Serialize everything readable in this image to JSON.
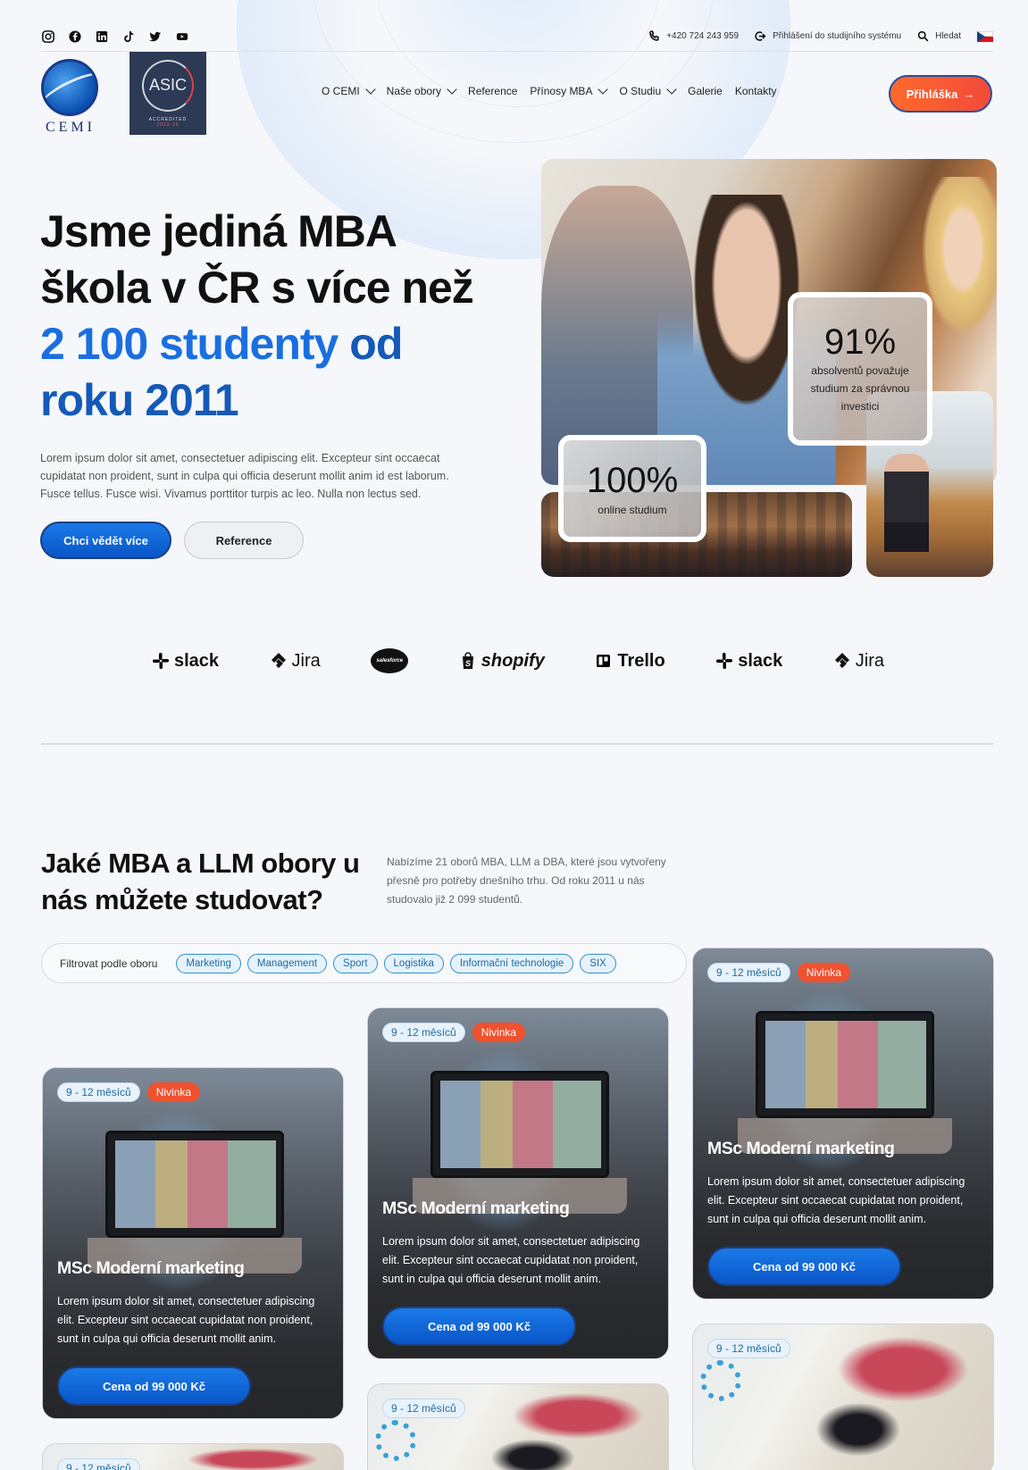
{
  "topbar": {
    "socials": [
      "instagram-icon",
      "facebook-icon",
      "linkedin-icon",
      "tiktok-icon",
      "twitter-icon",
      "youtube-icon"
    ],
    "phone": "+420 724 243 959",
    "login": "Přihlášení do studijního systému",
    "search": "Hledat",
    "language": "cs"
  },
  "header": {
    "logo_text": "CEMI",
    "asic": {
      "text": "ASIC",
      "accredited": "ACCREDITED",
      "years": "2023-26"
    },
    "nav": [
      {
        "label": "O CEMI",
        "dropdown": true
      },
      {
        "label": "Naše obory",
        "dropdown": true
      },
      {
        "label": "Reference",
        "dropdown": false
      },
      {
        "label": "Přínosy MBA",
        "dropdown": true
      },
      {
        "label": "O Studiu",
        "dropdown": true
      },
      {
        "label": "Galerie",
        "dropdown": false
      },
      {
        "label": "Kontakty",
        "dropdown": false
      }
    ],
    "apply_label": "Přihláška",
    "apply_arrow": "→"
  },
  "hero": {
    "title_part1": "Jsme jediná MBA škola v ČR s více než ",
    "title_highlight": "2 100 studenty",
    "title_highlight2": "od roku 2011",
    "text": "Lorem ipsum dolor sit amet, consectetuer adipiscing elit. Excepteur sint occaecat cupidatat non proident, sunt in culpa qui officia deserunt mollit anim id est laborum. Fusce tellus. Fusce wisi. Vivamus porttitor turpis ac leo. Nulla non lectus sed.",
    "primary_btn": "Chci vědět více",
    "secondary_btn": "Reference",
    "stat1_value": "91%",
    "stat1_label": "absolventů považuje studium za správnou investici",
    "stat2_value": "100%",
    "stat2_label": "online studium"
  },
  "brands": [
    "slack",
    "Jira",
    "salesforce",
    "shopify",
    "Trello",
    "slack",
    "Jira"
  ],
  "programs": {
    "title": "Jaké MBA a LLM obory u nás můžete studovat?",
    "text": "Nabízíme 21 oborů MBA, LLM a DBA, které jsou vytvořeny přesně pro potřeby dnešního trhu. Od roku 2011 u nás studovalo již 2 099 studentů.",
    "filter_label": "Filtrovat podle oboru",
    "filters": [
      "Marketing",
      "Management",
      "Sport",
      "Logistika",
      "Informační technologie",
      "SIX"
    ],
    "card": {
      "duration": "9 - 12 měsíců",
      "badge": "Nivinka",
      "title": "MSc Moderní marketing",
      "text": "Lorem ipsum dolor sit amet, consectetuer adipiscing elit. Excepteur sint occaecat cupidatat non proident, sunt in culpa qui officia deserunt mollit anim.",
      "price": "Cena od 99 000 Kč"
    },
    "card_bottom_duration": "9 - 12 měsíců"
  }
}
